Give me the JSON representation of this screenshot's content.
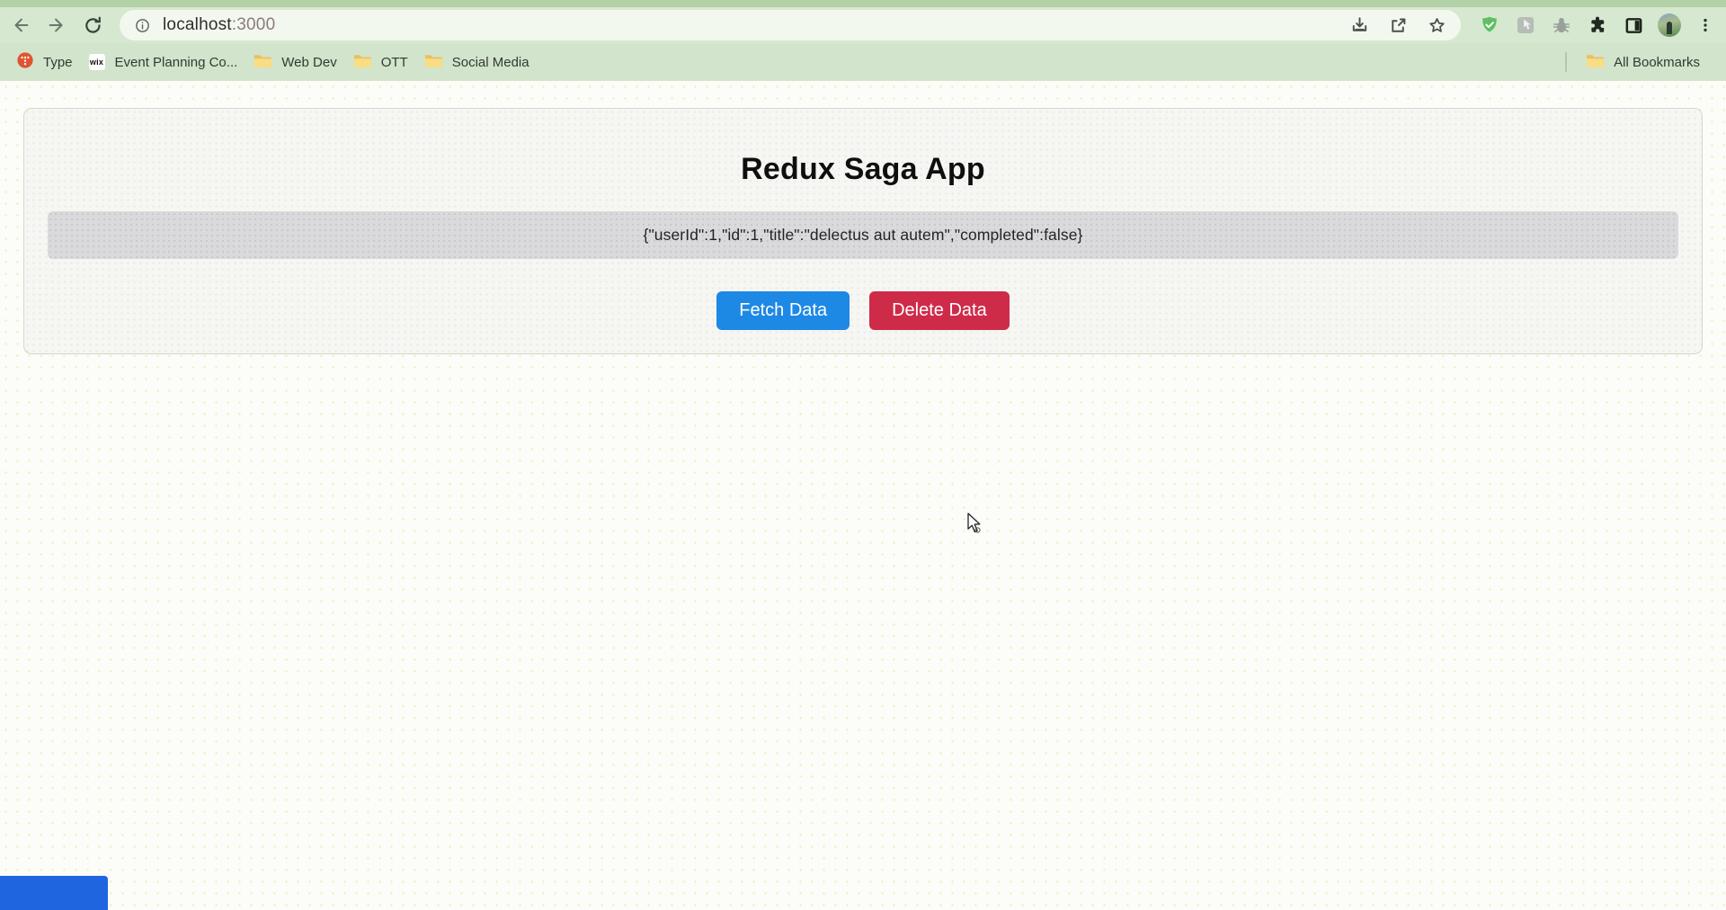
{
  "browser": {
    "url": {
      "host": "localhost",
      "port": ":3000"
    },
    "bookmarks_bar": {
      "items": [
        {
          "label": "Type"
        },
        {
          "label": "Event Planning Co..."
        },
        {
          "label": "Web Dev"
        },
        {
          "label": "OTT"
        },
        {
          "label": "Social Media"
        }
      ],
      "wix_icon_text": "wix",
      "all_bookmarks_label": "All Bookmarks"
    }
  },
  "page": {
    "title": "Redux Saga App",
    "json_output": "{\"userId\":1,\"id\":1,\"title\":\"delectus aut autem\",\"completed\":false}",
    "buttons": {
      "fetch_label": "Fetch Data",
      "delete_label": "Delete Data"
    }
  },
  "colors": {
    "theme_green_toolbar": "#d6e8d0",
    "theme_green_bookmarks": "#d2e4cb",
    "fetch_button_blue": "#1e88e5",
    "delete_button_red": "#ce2b49",
    "status_bubble_blue": "#1f65e0",
    "json_strip_gray": "#dadadc",
    "adguard_green": "#5fbf62"
  }
}
